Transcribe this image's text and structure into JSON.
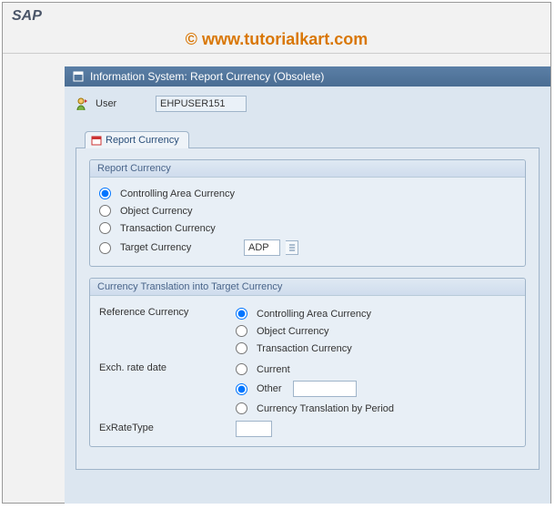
{
  "app": {
    "title": "SAP"
  },
  "watermark": {
    "copy": "©",
    "text": " www.tutorialkart.com"
  },
  "window": {
    "title": "Information System: Report Currency (Obsolete)"
  },
  "user": {
    "label": "User",
    "value": "EHPUSER151"
  },
  "tabs": [
    {
      "label": "Report Currency"
    }
  ],
  "group1": {
    "title": "Report Currency",
    "options": {
      "controlling": "Controlling Area Currency",
      "object": "Object Currency",
      "transaction": "Transaction Currency",
      "target": "Target Currency"
    },
    "target_value": "ADP"
  },
  "group2": {
    "title": "Currency Translation into Target Currency",
    "labels": {
      "ref_currency": "Reference Currency",
      "exch_rate_date": "Exch. rate date",
      "exratetype": "ExRateType"
    },
    "ref_options": {
      "controlling": "Controlling Area Currency",
      "object": "Object Currency",
      "transaction": "Transaction Currency"
    },
    "date_options": {
      "current": "Current",
      "other": "Other",
      "by_period": "Currency Translation by Period"
    },
    "other_value": "",
    "exratetype_value": ""
  }
}
